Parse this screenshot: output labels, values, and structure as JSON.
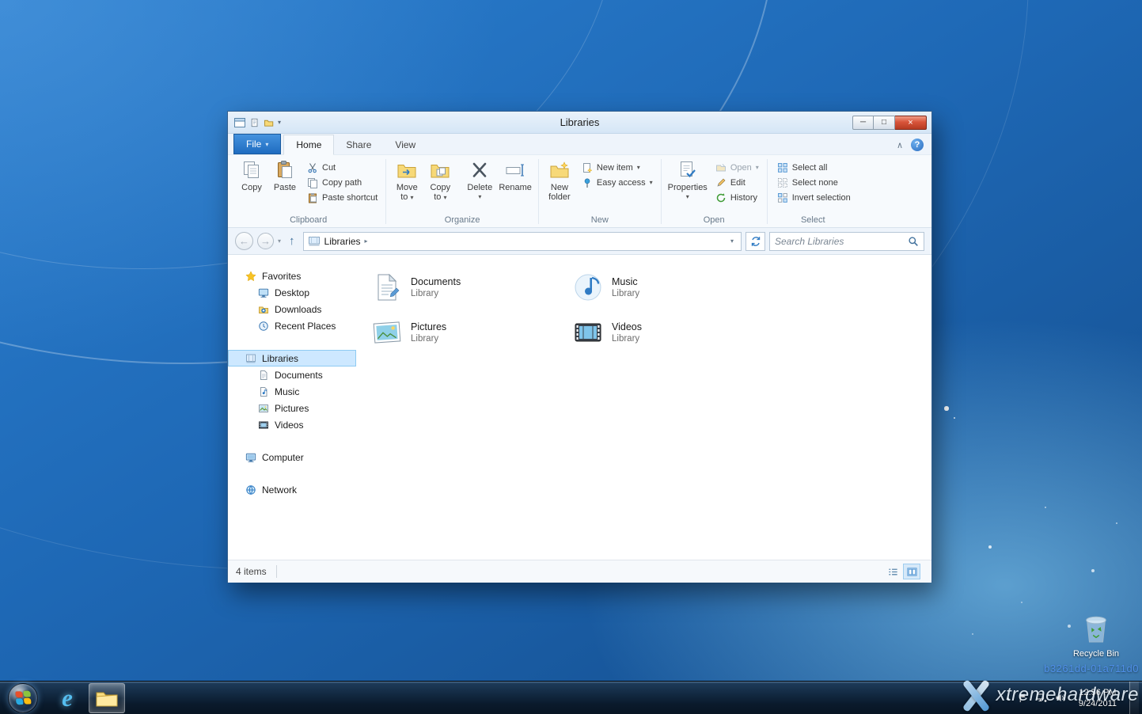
{
  "desktop": {
    "recycle_bin_label": "Recycle Bin",
    "watermark": {
      "build": "b3261dd-01a711d0",
      "brand": "xtremehardware"
    }
  },
  "taskbar": {
    "time": "12:56 PM",
    "date": "9/24/2011"
  },
  "window": {
    "title": "Libraries",
    "tabs": {
      "file": "File",
      "home": "Home",
      "share": "Share",
      "view": "View"
    },
    "ribbon": {
      "clipboard": {
        "label": "Clipboard",
        "copy": "Copy",
        "paste": "Paste",
        "cut": "Cut",
        "copy_path": "Copy path",
        "paste_shortcut": "Paste shortcut"
      },
      "organize": {
        "label": "Organize",
        "move_1": "Move",
        "move_2": "to",
        "copyto_1": "Copy",
        "copyto_2": "to",
        "delete": "Delete",
        "rename": "Rename"
      },
      "new": {
        "label": "New",
        "new_folder_1": "New",
        "new_folder_2": "folder",
        "new_item": "New item",
        "easy_access": "Easy access"
      },
      "open": {
        "label": "Open",
        "properties": "Properties",
        "open": "Open",
        "edit": "Edit",
        "history": "History"
      },
      "select": {
        "label": "Select",
        "select_all": "Select all",
        "select_none": "Select none",
        "invert": "Invert selection"
      }
    },
    "address": {
      "crumb_root": "Libraries",
      "search_placeholder": "Search Libraries"
    },
    "nav": {
      "favorites": "Favorites",
      "favorites_items": [
        "Desktop",
        "Downloads",
        "Recent Places"
      ],
      "libraries": "Libraries",
      "libraries_items": [
        "Documents",
        "Music",
        "Pictures",
        "Videos"
      ],
      "computer": "Computer",
      "network": "Network"
    },
    "items": [
      {
        "name": "Documents",
        "sub": "Library"
      },
      {
        "name": "Music",
        "sub": "Library"
      },
      {
        "name": "Pictures",
        "sub": "Library"
      },
      {
        "name": "Videos",
        "sub": "Library"
      }
    ],
    "status": {
      "count": "4 items"
    }
  },
  "glyphs": {
    "dropdown": "▾",
    "crumb": "▸",
    "back": "←",
    "forward": "→",
    "up": "↑",
    "chevron_up": "∧",
    "help": "?",
    "minimize": "─",
    "maximize": "□",
    "close": "×",
    "hidden_icons": "▴",
    "ie": "e"
  },
  "colors": {
    "accent_blue": "#2f7bc4",
    "selection": "#cde8ff",
    "file_tab": "#1f6cc0",
    "close_red": "#d8543a",
    "desktop_blue": "#1e68b5",
    "taskbar_dark": "#10263d"
  }
}
